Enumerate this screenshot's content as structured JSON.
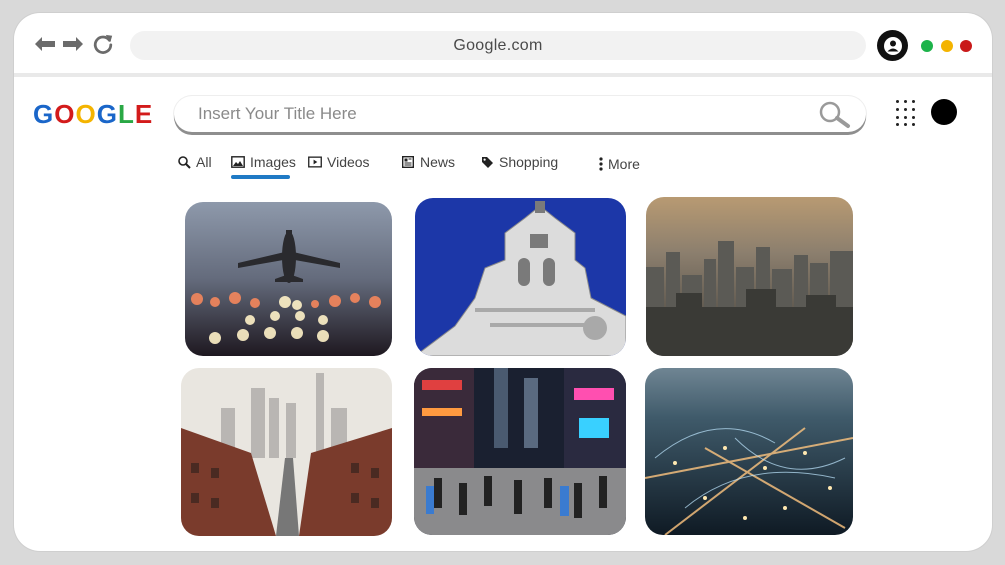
{
  "browser": {
    "address": "Google.com",
    "window_controls": {
      "green": "#1db34a",
      "yellow": "#f4b400",
      "red": "#c91a1a"
    }
  },
  "logo": {
    "letters": [
      "G",
      "O",
      "O",
      "G",
      "L",
      "E"
    ],
    "colors": [
      "#1a66c9",
      "#d31b1b",
      "#f4b400",
      "#1a66c9",
      "#2aa845",
      "#d31b1b"
    ]
  },
  "search": {
    "placeholder": "Insert Your Title Here"
  },
  "tabs": [
    {
      "label": "All",
      "icon": "search-icon"
    },
    {
      "label": "Images",
      "icon": "image-icon",
      "active": true
    },
    {
      "label": "Videos",
      "icon": "video-icon"
    },
    {
      "label": "News",
      "icon": "news-icon"
    },
    {
      "label": "Shopping",
      "icon": "tag-icon"
    },
    {
      "label": "More",
      "icon": "more-vertical-icon"
    }
  ],
  "accent_color": "#1f7ac5",
  "results": [
    {
      "subject": "airplane-takeoff"
    },
    {
      "subject": "ornate-tower"
    },
    {
      "subject": "city-skyline-dusk"
    },
    {
      "subject": "city-street-aerial"
    },
    {
      "subject": "neon-crowd-street"
    },
    {
      "subject": "night-city-network"
    }
  ]
}
